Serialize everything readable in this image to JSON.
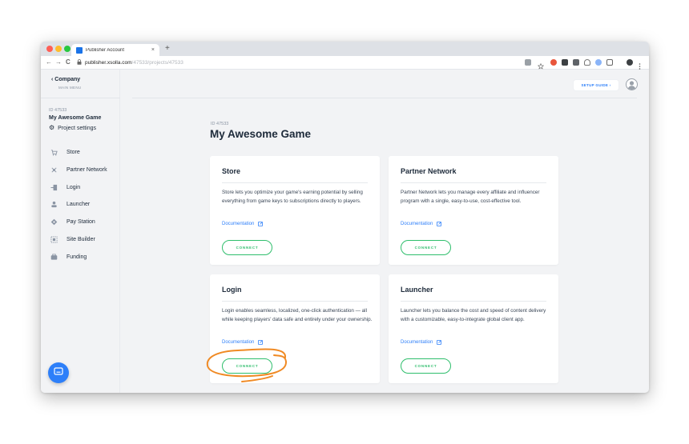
{
  "browser": {
    "tab_title": "Publisher Account",
    "tab_close": "×",
    "new_tab": "+",
    "back": "←",
    "forward": "→",
    "reload": "C",
    "url_host": "publisher.xsolla.com",
    "url_path": "/47533/projects/47533",
    "traffic_colors": [
      "#fe5f57",
      "#febc2e",
      "#28c840"
    ]
  },
  "sidebar": {
    "back_label": "‹  Company",
    "main_menu": "MAIN MENU",
    "project_id": "ID 47533",
    "project_name": "My Awesome Game",
    "project_settings": "Project settings",
    "items": [
      {
        "label": "Store",
        "icon": "store-icon"
      },
      {
        "label": "Partner Network",
        "icon": "partner-network-icon"
      },
      {
        "label": "Login",
        "icon": "login-icon"
      },
      {
        "label": "Launcher",
        "icon": "launcher-icon"
      },
      {
        "label": "Pay Station",
        "icon": "pay-station-icon"
      },
      {
        "label": "Site Builder",
        "icon": "site-builder-icon"
      },
      {
        "label": "Funding",
        "icon": "funding-icon"
      }
    ]
  },
  "header": {
    "setup_guide": "SETUP GUIDE  ›"
  },
  "page": {
    "id": "ID 47533",
    "title": "My Awesome Game"
  },
  "cards": [
    {
      "title": "Store",
      "description": "Store lets you optimize your game's earning potential by selling everything from game keys to subscriptions directly to players.",
      "doc_label": "Documentation",
      "connect_label": "CONNECT"
    },
    {
      "title": "Partner Network",
      "description": "Partner Network lets you manage every affiliate and influencer program with a single, easy-to-use, cost-effective tool.",
      "doc_label": "Documentation",
      "connect_label": "CONNECT"
    },
    {
      "title": "Login",
      "description": "Login enables seamless, localized, one-click authentication — all while keeping players' data safe and entirely under your ownership.",
      "doc_label": "Documentation",
      "connect_label": "CONNECT"
    },
    {
      "title": "Launcher",
      "description": "Launcher lets you balance the cost and speed of content delivery with a customizable, easy-to-integrate global client app.",
      "doc_label": "Documentation",
      "connect_label": "CONNECT"
    }
  ],
  "colors": {
    "accent_blue": "#2d7ff9",
    "connect_green": "#2fbe6c",
    "highlight_orange": "#f08a24",
    "text_dark": "#1d2a3a"
  }
}
